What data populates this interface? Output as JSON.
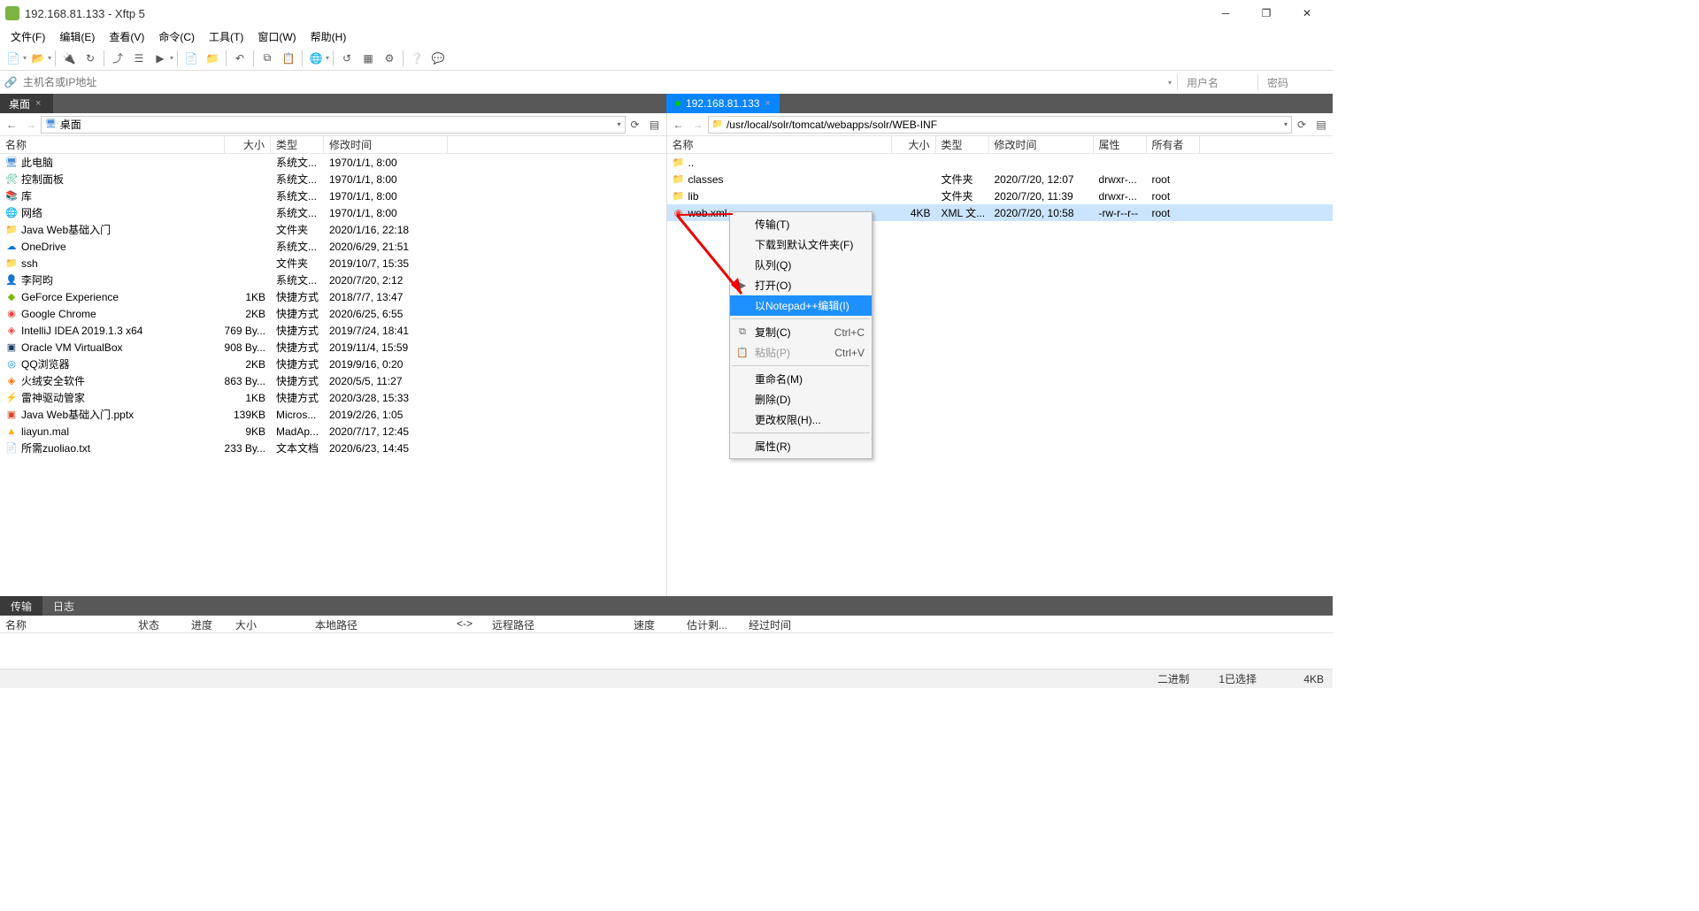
{
  "title": "192.168.81.133 - Xftp 5",
  "menu": [
    "文件(F)",
    "编辑(E)",
    "查看(V)",
    "命令(C)",
    "工具(T)",
    "窗口(W)",
    "帮助(H)"
  ],
  "address_placeholder": "主机名或IP地址",
  "user_placeholder": "用户名",
  "pass_placeholder": "密码",
  "local_tab": "桌面",
  "remote_tab": "192.168.81.133",
  "local_path": "桌面",
  "remote_path": "/usr/local/solr/tomcat/webapps/solr/WEB-INF",
  "local_cols": {
    "name": "名称",
    "size": "大小",
    "type": "类型",
    "mod": "修改时间"
  },
  "remote_cols": {
    "name": "名称",
    "size": "大小",
    "type": "类型",
    "mod": "修改时间",
    "perm": "属性",
    "own": "所有者"
  },
  "local_rows": [
    {
      "icon": "pc",
      "name": "此电脑",
      "size": "",
      "type": "系统文...",
      "mod": "1970/1/1, 8:00"
    },
    {
      "icon": "panel",
      "name": "控制面板",
      "size": "",
      "type": "系统文...",
      "mod": "1970/1/1, 8:00"
    },
    {
      "icon": "lib",
      "name": "库",
      "size": "",
      "type": "系统文...",
      "mod": "1970/1/1, 8:00"
    },
    {
      "icon": "net",
      "name": "网络",
      "size": "",
      "type": "系统文...",
      "mod": "1970/1/1, 8:00"
    },
    {
      "icon": "fld",
      "name": "Java Web基础入门",
      "size": "",
      "type": "文件夹",
      "mod": "2020/1/16, 22:18"
    },
    {
      "icon": "onedrive",
      "name": "OneDrive",
      "size": "",
      "type": "系统文...",
      "mod": "2020/6/29, 21:51"
    },
    {
      "icon": "fld",
      "name": "ssh",
      "size": "",
      "type": "文件夹",
      "mod": "2019/10/7, 15:35"
    },
    {
      "icon": "user",
      "name": "李阿昀",
      "size": "",
      "type": "系统文...",
      "mod": "2020/7/20, 2:12"
    },
    {
      "icon": "nv",
      "name": "GeForce Experience",
      "size": "1KB",
      "type": "快捷方式",
      "mod": "2018/7/7, 13:47"
    },
    {
      "icon": "chrome",
      "name": "Google Chrome",
      "size": "2KB",
      "type": "快捷方式",
      "mod": "2020/6/25, 6:55"
    },
    {
      "icon": "idea",
      "name": "IntelliJ IDEA 2019.1.3 x64",
      "size": "769 By...",
      "type": "快捷方式",
      "mod": "2019/7/24, 18:41"
    },
    {
      "icon": "vbox",
      "name": "Oracle VM VirtualBox",
      "size": "908 By...",
      "type": "快捷方式",
      "mod": "2019/11/4, 15:59"
    },
    {
      "icon": "qq",
      "name": "QQ浏览器",
      "size": "2KB",
      "type": "快捷方式",
      "mod": "2019/9/16, 0:20"
    },
    {
      "icon": "tinder",
      "name": "火绒安全软件",
      "size": "863 By...",
      "type": "快捷方式",
      "mod": "2020/5/5, 11:27"
    },
    {
      "icon": "thunder",
      "name": "雷神驱动管家",
      "size": "1KB",
      "type": "快捷方式",
      "mod": "2020/3/28, 15:33"
    },
    {
      "icon": "ppt",
      "name": "Java Web基础入门.pptx",
      "size": "139KB",
      "type": "Micros...",
      "mod": "2019/2/26, 1:05"
    },
    {
      "icon": "mal",
      "name": "liayun.mal",
      "size": "9KB",
      "type": "MadAp...",
      "mod": "2020/7/17, 12:45"
    },
    {
      "icon": "txt",
      "name": "所需zuoliao.txt",
      "size": "233 By...",
      "type": "文本文档",
      "mod": "2020/6/23, 14:45"
    }
  ],
  "remote_rows": [
    {
      "icon": "up",
      "name": "..",
      "size": "",
      "type": "",
      "mod": "",
      "perm": "",
      "own": ""
    },
    {
      "icon": "fld",
      "name": "classes",
      "size": "",
      "type": "文件夹",
      "mod": "2020/7/20, 12:07",
      "perm": "drwxr-...",
      "own": "root"
    },
    {
      "icon": "fld",
      "name": "lib",
      "size": "",
      "type": "文件夹",
      "mod": "2020/7/20, 11:39",
      "perm": "drwxr-...",
      "own": "root"
    },
    {
      "icon": "xml",
      "name": "web.xml",
      "size": "4KB",
      "type": "XML 文...",
      "mod": "2020/7/20, 10:58",
      "perm": "-rw-r--r--",
      "own": "root",
      "selected": true
    }
  ],
  "context_menu": [
    {
      "label": "传输(T)"
    },
    {
      "label": "下载到默认文件夹(F)"
    },
    {
      "label": "队列(Q)"
    },
    {
      "label": "打开(O)",
      "icon": "▶"
    },
    {
      "label": "以Notepad++编辑(I)",
      "hover": true
    },
    {
      "sep": true
    },
    {
      "label": "复制(C)",
      "shortcut": "Ctrl+C",
      "icon": "⧉"
    },
    {
      "label": "粘贴(P)",
      "shortcut": "Ctrl+V",
      "icon": "📋",
      "disabled": true
    },
    {
      "sep": true
    },
    {
      "label": "重命名(M)"
    },
    {
      "label": "删除(D)"
    },
    {
      "label": "更改权限(H)..."
    },
    {
      "sep": true
    },
    {
      "label": "属性(R)"
    }
  ],
  "bottom_tabs": [
    "传输",
    "日志"
  ],
  "transfer_cols": [
    "名称",
    "状态",
    "进度",
    "大小",
    "本地路径",
    "<->",
    "远程路径",
    "速度",
    "估计剩...",
    "经过时间"
  ],
  "status": {
    "mode": "二进制",
    "sel": "1已选择",
    "size": "4KB"
  }
}
